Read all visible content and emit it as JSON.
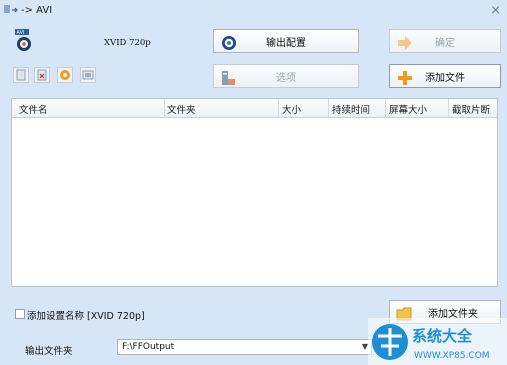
{
  "window": {
    "title": "-> AVI"
  },
  "profile": {
    "name": "XVID 720p"
  },
  "buttons": {
    "output_config": "输出配置",
    "confirm": "确定",
    "options": "选项",
    "add_file": "添加文件",
    "add_folder": "添加文件夹"
  },
  "table": {
    "columns": [
      "文件名",
      "文件夹",
      "大小",
      "持续时间",
      "屏幕大小",
      "截取片断"
    ],
    "rows": []
  },
  "checkbox": {
    "label": "添加设置名称 [XVID 720p]",
    "checked": false
  },
  "output": {
    "label": "输出文件夹",
    "value": "F:\\FFOutput"
  },
  "watermark": {
    "brand": "系统大全",
    "url": "WWW.XP85.COM"
  },
  "colors": {
    "window_bg": "#d6e6f7",
    "orange": "#f39a1a",
    "watermark_blue": "#1e8fd7"
  }
}
